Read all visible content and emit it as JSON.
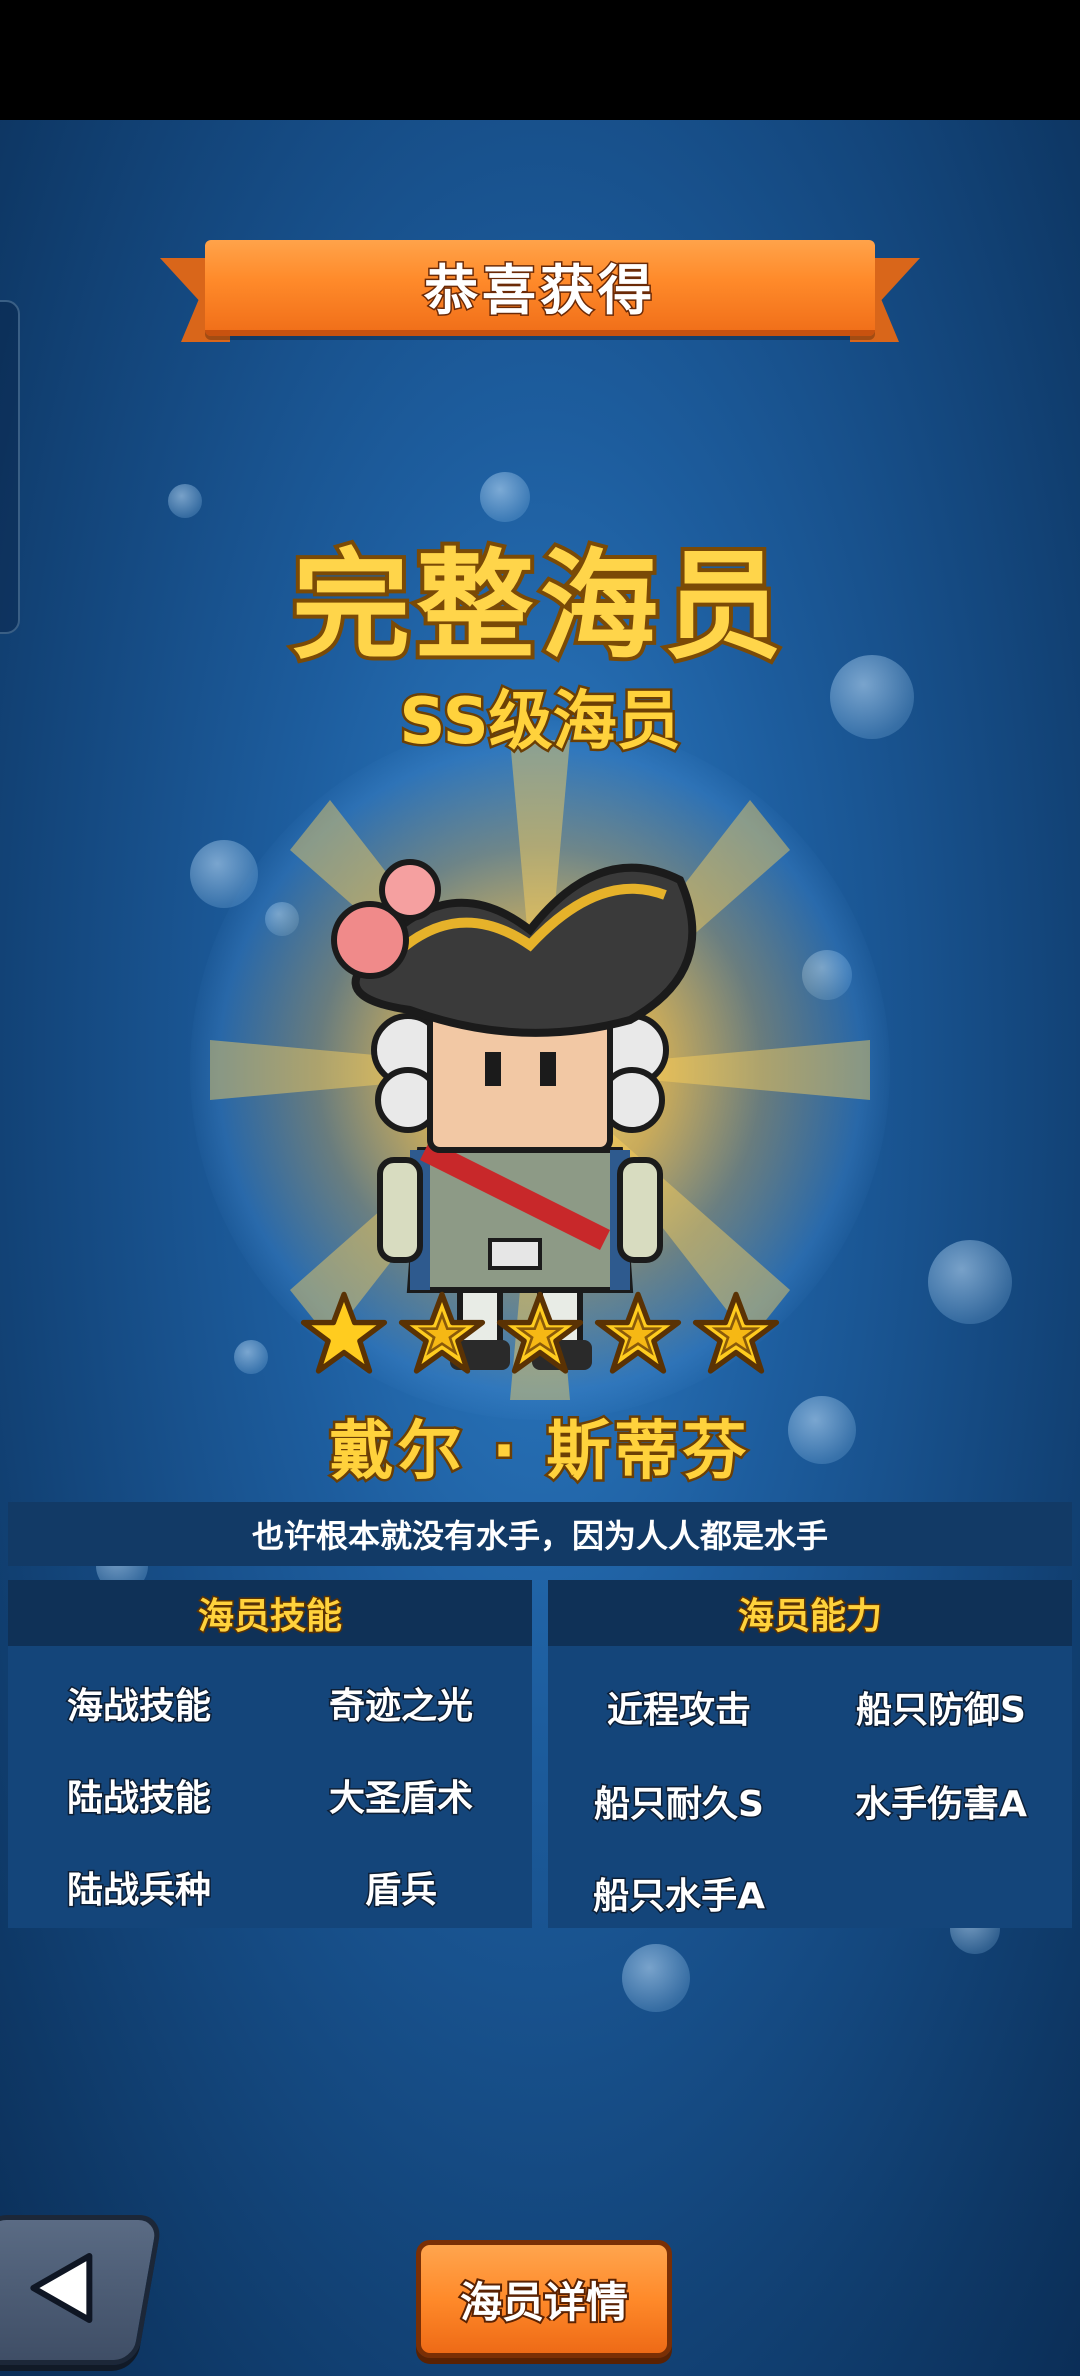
{
  "banner": {
    "title": "恭喜获得"
  },
  "reward": {
    "rarity": "完整海员",
    "grade": "SS级海员",
    "stars": 5,
    "name": "戴尔 · 斯蒂芬"
  },
  "quote": "也许根本就没有水手，因为人人都是水手",
  "skills_panel": {
    "header": "海员技能",
    "rows": [
      {
        "label": "海战技能",
        "value": "奇迹之光"
      },
      {
        "label": "陆战技能",
        "value": "大圣盾术"
      },
      {
        "label": "陆战兵种",
        "value": "盾兵"
      }
    ]
  },
  "abilities_panel": {
    "header": "海员能力",
    "items": [
      "近程攻击",
      "船只防御S",
      "船只耐久S",
      "水手伤害A",
      "船只水手A"
    ]
  },
  "buttons": {
    "details": "海员详情"
  },
  "colors": {
    "accent_gold": "#ffd23c",
    "banner_orange": "#ff8a2a",
    "panel_blue": "#14457a"
  }
}
